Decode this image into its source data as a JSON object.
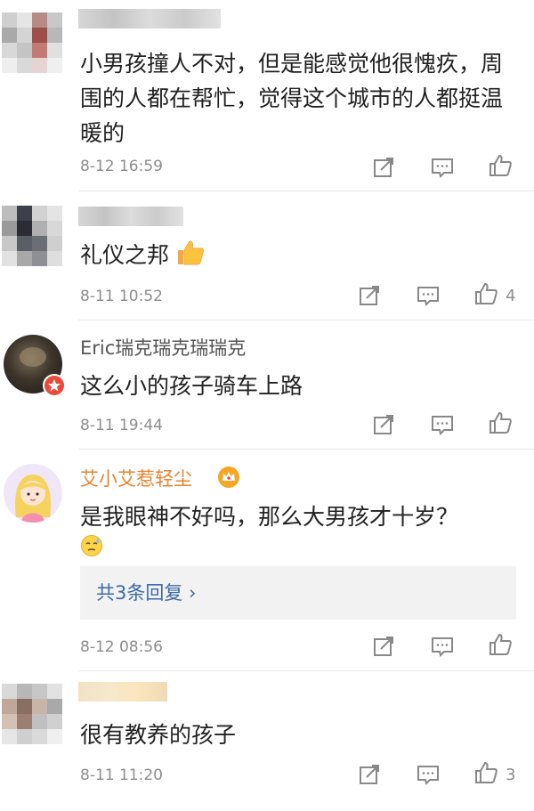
{
  "comments": [
    {
      "text": "小男孩撞人不对，但是能感觉他很愧疚，周围的人都在帮忙，觉得这个城市的人都挺温暖的",
      "time": "8-12 16:59",
      "likes": ""
    },
    {
      "text": "礼仪之邦",
      "emoji": "thumbs-up-emoji",
      "time": "8-11 10:52",
      "likes": "4"
    },
    {
      "username": "Eric瑞克瑞克瑞瑞克",
      "text": "这么小的孩子骑车上路",
      "time": "8-11 19:44",
      "likes": ""
    },
    {
      "username": "艾小艾惹轻尘",
      "text": "是我眼神不好吗，那么大男孩才十岁？",
      "emoji": "sweat-face-emoji",
      "reply_link": "共3条回复 ›",
      "time": "8-12 08:56",
      "likes": ""
    },
    {
      "text": "很有教养的孩子",
      "time": "8-11 11:20",
      "likes": "3"
    }
  ],
  "icons": {
    "repost": "repost-icon",
    "comment": "comment-icon",
    "like": "thumbs-up-icon",
    "vip": "crown-badge-icon"
  },
  "colors": {
    "vip_name": "#e8832e",
    "reply_link": "#3d6aa6",
    "timestamp": "#8d8d8d"
  }
}
